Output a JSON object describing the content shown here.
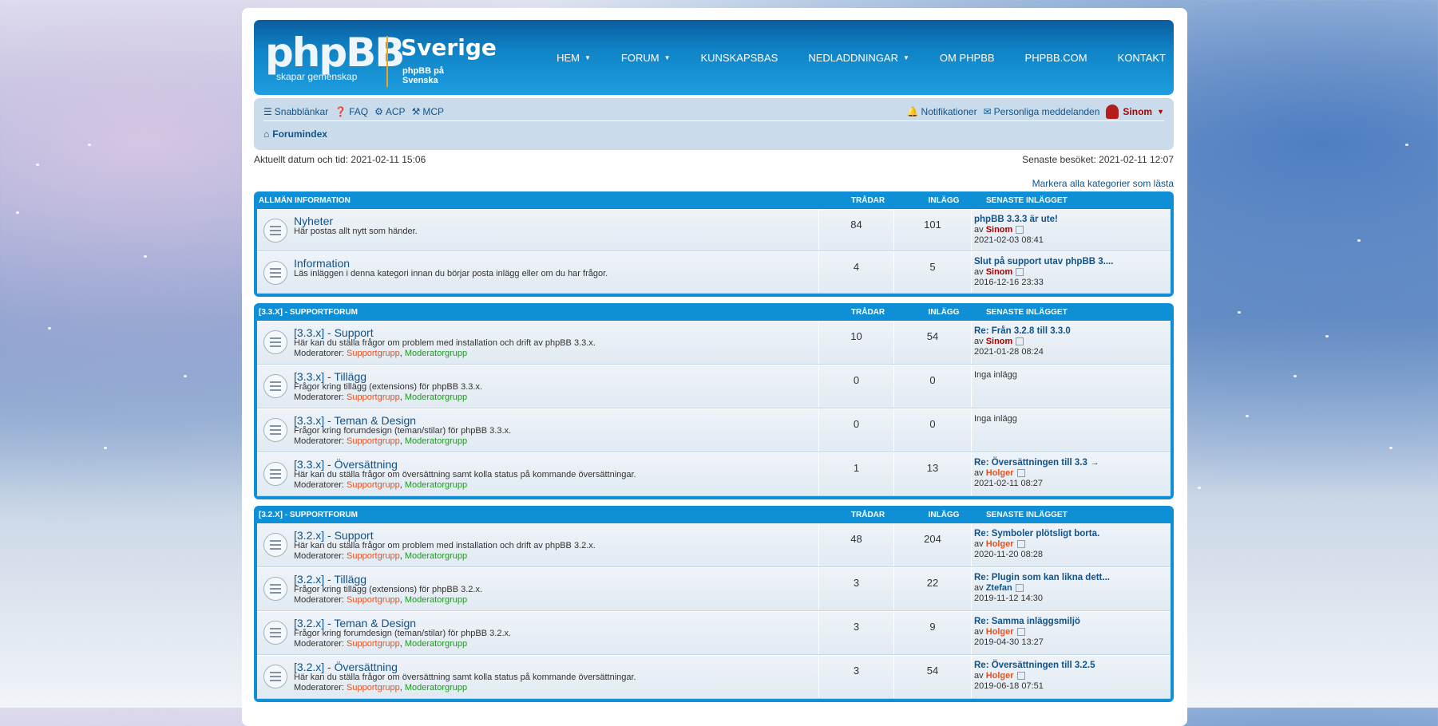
{
  "header": {
    "logo_text": "phpBB",
    "logo_sub": "skapar gemenskap",
    "site_name": "Sverige",
    "site_sub": "phpBB på Svenska",
    "nav": [
      "HEM",
      "FORUM",
      "KUNSKAPSBAS",
      "NEDLADDNINGAR",
      "OM PHPBB",
      "PHPBB.COM",
      "KONTAKT"
    ]
  },
  "navbar": {
    "quicklinks": "Snabblänkar",
    "faq": "FAQ",
    "acp": "ACP",
    "mcp": "MCP",
    "notifications": "Notifikationer",
    "pm": "Personliga meddelanden",
    "user": "Sinom",
    "breadcrumb": "Forumindex"
  },
  "info": {
    "current": "Aktuellt datum och tid: 2021-02-11 15:06",
    "last_visit": "Senaste besöket: 2021-02-11 12:07",
    "mark_all": "Markera alla kategorier som lästa"
  },
  "columns": {
    "topics": "TRÅDAR",
    "posts": "INLÄGG",
    "last": "SENASTE INLÄGGET"
  },
  "common": {
    "moderators": "Moderatorer:",
    "mod1": "Supportgrupp",
    "mod2": "Moderatorgrupp",
    "by": "av",
    "no_posts": "Inga inlägg"
  },
  "categories": [
    {
      "name": "ALLMÄN INFORMATION",
      "forums": [
        {
          "title": "Nyheter",
          "desc": "Här postas allt nytt som händer.",
          "topics": "84",
          "posts": "101",
          "last_title": "phpBB 3.3.3 är ute!",
          "last_author": "Sinom",
          "last_date": "2021-02-03 08:41"
        },
        {
          "title": "Information",
          "desc": "Läs inläggen i denna kategori innan du börjar posta inlägg eller om du har frågor.",
          "topics": "4",
          "posts": "5",
          "last_title": "Slut på support utav phpBB 3....",
          "last_author": "Sinom",
          "last_date": "2016-12-16 23:33"
        }
      ]
    },
    {
      "name": "[3.3.X] - SUPPORTFORUM",
      "forums": [
        {
          "title": "[3.3.x] - Support",
          "desc": "Här kan du ställa frågor om problem med installation och drift av phpBB 3.3.x.",
          "topics": "10",
          "posts": "54",
          "last_title": "Re: Från 3.2.8 till 3.3.0",
          "last_author": "Sinom",
          "last_date": "2021-01-28 08:24"
        },
        {
          "title": "[3.3.x] - Tillägg",
          "desc": "Frågor kring tillägg (extensions) för phpBB 3.3.x.",
          "topics": "0",
          "posts": "0"
        },
        {
          "title": "[3.3.x] - Teman & Design",
          "desc": "Frågor kring forumdesign (teman/stilar) för phpBB 3.3.x.",
          "topics": "0",
          "posts": "0"
        },
        {
          "title": "[3.3.x] - Översättning",
          "desc": "Här kan du ställa frågor om översättning samt kolla status på kommande översättningar.",
          "topics": "1",
          "posts": "13",
          "last_title": "Re: Översättningen till 3.3 →",
          "last_author": "Holger",
          "last_date": "2021-02-11 08:27"
        }
      ]
    },
    {
      "name": "[3.2.X] - SUPPORTFORUM",
      "forums": [
        {
          "title": "[3.2.x] - Support",
          "desc": "Här kan du ställa frågor om problem med installation och drift av phpBB 3.2.x.",
          "topics": "48",
          "posts": "204",
          "last_title": "Re: Symboler plötsligt borta.",
          "last_author": "Holger",
          "last_date": "2020-11-20 08:28"
        },
        {
          "title": "[3.2.x] - Tillägg",
          "desc": "Frågor kring tillägg (extensions) för phpBB 3.2.x.",
          "topics": "3",
          "posts": "22",
          "last_title": "Re: Plugin som kan likna dett...",
          "last_author": "Ztefan",
          "last_date": "2019-11-12 14:30"
        },
        {
          "title": "[3.2.x] - Teman & Design",
          "desc": "Frågor kring forumdesign (teman/stilar) för phpBB 3.2.x.",
          "topics": "3",
          "posts": "9",
          "last_title": "Re: Samma inläggsmiljö",
          "last_author": "Holger",
          "last_date": "2019-04-30 13:27"
        },
        {
          "title": "[3.2.x] - Översättning",
          "desc": "Här kan du ställa frågor om översättning samt kolla status på kommande översättningar.",
          "topics": "3",
          "posts": "54",
          "last_title": "Re: Översättningen till 3.2.5",
          "last_author": "Holger",
          "last_date": "2019-06-18 07:51"
        }
      ]
    }
  ]
}
